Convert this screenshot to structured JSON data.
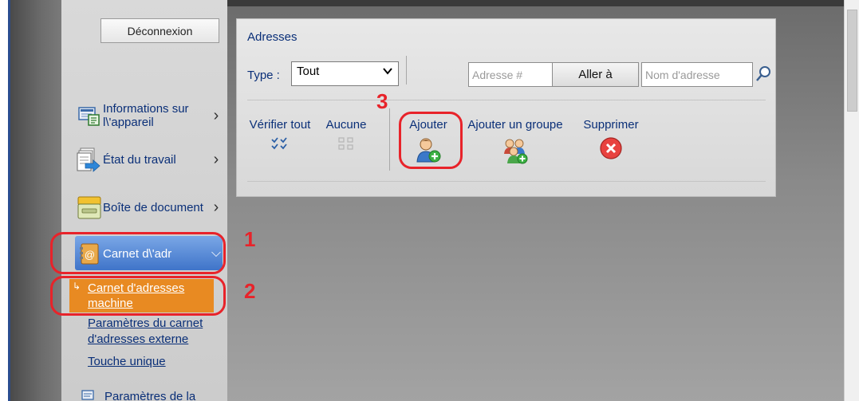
{
  "sidebar": {
    "logout_label": "Déconnexion",
    "items": [
      {
        "label_line1": "Informations sur",
        "label_line2": "l\\'appareil",
        "icon": "device-info-icon"
      },
      {
        "label": "État du travail",
        "icon": "job-status-icon"
      },
      {
        "label": "Boîte de document",
        "icon": "document-box-icon"
      },
      {
        "label": "Carnet d\\'adr",
        "icon": "address-book-icon"
      }
    ],
    "sub_items": [
      {
        "line1": "Carnet d'adresses",
        "line2": "machine"
      },
      {
        "line1": "Paramètres du carnet",
        "line2": "d'adresses externe"
      },
      {
        "line1": "Touche unique"
      }
    ],
    "bottom_item": "Paramètres de la"
  },
  "panel": {
    "title": "Adresses",
    "type_label": "Type :",
    "type_value": "Tout",
    "address_number_placeholder": "Adresse #",
    "go_label": "Aller à",
    "address_name_placeholder": "Nom d'adresse",
    "actions": {
      "check_all": "Vérifier tout",
      "none": "Aucune",
      "add": "Ajouter",
      "add_group": "Ajouter un groupe",
      "delete": "Supprimer"
    }
  },
  "callouts": [
    "1",
    "2",
    "3"
  ],
  "colors": {
    "accent_red": "#e8232a",
    "selected_blue": "#3f74c9",
    "selected_orange": "#e88a22",
    "link_blue": "#0a2f78"
  }
}
